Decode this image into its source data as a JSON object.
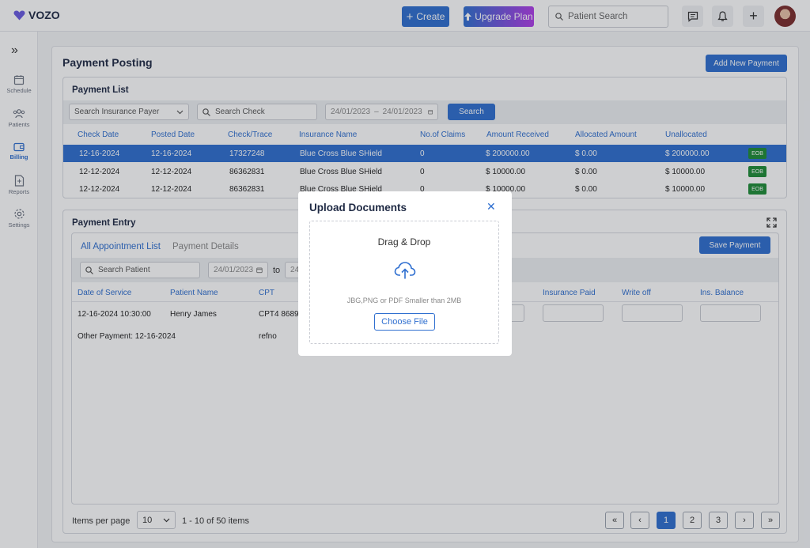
{
  "app": {
    "logo_text": "VOZO",
    "brand_color": "#2f6fd0"
  },
  "topbar": {
    "create_label": "Create",
    "upgrade_label": "Upgrade Plan",
    "search_placeholder": "Patient Search"
  },
  "sidebar": {
    "items": [
      {
        "label": "Schedule",
        "icon": "calendar-icon"
      },
      {
        "label": "Patients",
        "icon": "users-icon"
      },
      {
        "label": "Billing",
        "icon": "wallet-icon",
        "active": true
      },
      {
        "label": "Reports",
        "icon": "report-icon"
      },
      {
        "label": "Settings",
        "icon": "gear-icon"
      }
    ]
  },
  "page": {
    "title": "Payment Posting",
    "add_button": "Add New Payment"
  },
  "payment_list": {
    "title": "Payment List",
    "payer_placeholder": "Search Insurance Payer",
    "check_placeholder": "Search Check",
    "date_from": "24/01/2023",
    "date_sep": "–",
    "date_to": "24/01/2023",
    "search_button": "Search",
    "columns": [
      "Check Date",
      "Posted Date",
      "Check/Trace",
      "Insurance Name",
      "No.of Claims",
      "Amount Received",
      "Allocated Amount",
      "Unallocated"
    ],
    "rows": [
      {
        "check_date": "12-16-2024",
        "posted_date": "12-16-2024",
        "trace": "17327248",
        "insurance": "Blue Cross Blue SHield",
        "claims": "0",
        "received": "$ 200000.00",
        "allocated": "$ 0.00",
        "unallocated": "$ 200000.00",
        "badge": "EOB"
      },
      {
        "check_date": "12-12-2024",
        "posted_date": "12-12-2024",
        "trace": "86362831",
        "insurance": "Blue Cross Blue SHield",
        "claims": "0",
        "received": "$ 10000.00",
        "allocated": "$ 0.00",
        "unallocated": "$ 10000.00",
        "badge": "EOB"
      },
      {
        "check_date": "12-12-2024",
        "posted_date": "12-12-2024",
        "trace": "86362831",
        "insurance": "Blue Cross Blue SHield",
        "claims": "0",
        "received": "$ 10000.00",
        "allocated": "$ 0.00",
        "unallocated": "$ 10000.00",
        "badge": "EOB"
      }
    ]
  },
  "payment_entry": {
    "title": "Payment Entry",
    "tabs": [
      "All Appointment List",
      "Payment Details"
    ],
    "save_button": "Save Payment",
    "patient_placeholder": "Search Patient",
    "date_from": "24/01/2023",
    "to_label": "to",
    "date_to_partial": "24/",
    "columns": [
      "Date of Service",
      "Patient Name",
      "CPT",
      "Insurance Paid",
      "Write off",
      "Ins. Balance"
    ],
    "row": {
      "dos": "12-16-2024 10:30:00",
      "patient": "Henry James",
      "cpt": "CPT4 86891"
    },
    "other_payment": "Other Payment: 12-16-2024",
    "other_ref": "refno"
  },
  "pagination": {
    "items_label": "Items per page",
    "per_page": "10",
    "range": "1 - 10 of 50 items",
    "first": "«",
    "prev": "‹",
    "pages": [
      "1",
      "2",
      "3"
    ],
    "next": "›",
    "last": "»"
  },
  "modal": {
    "title": "Upload Documents",
    "drop_title": "Drag & Drop",
    "hint": "JBG,PNG or PDF Smaller than 2MB",
    "choose_button": "Choose File"
  }
}
